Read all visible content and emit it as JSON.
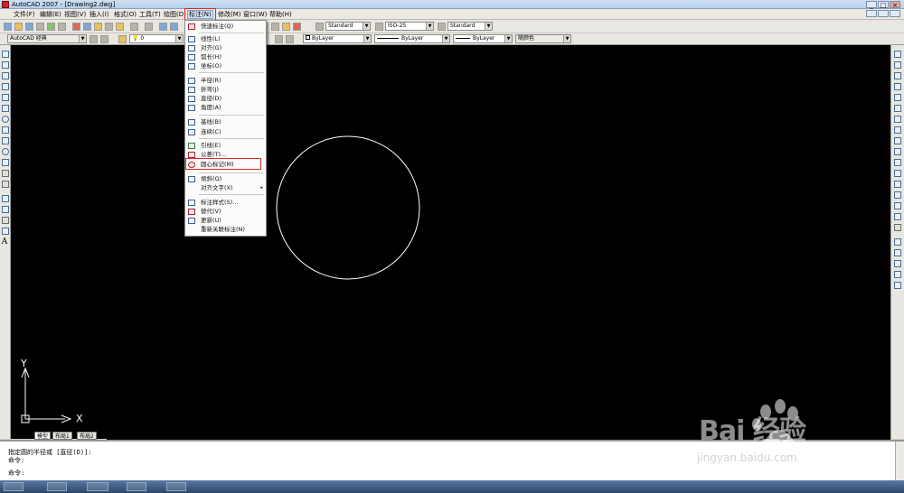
{
  "title": "AutoCAD 2007 - [Drawing2.dwg]",
  "window_buttons": [
    "_",
    "□",
    "×"
  ],
  "menu": [
    "文件(F)",
    "编辑(E)",
    "视图(V)",
    "插入(I)",
    "格式(O)",
    "工具(T)",
    "绘图(D)",
    "标注(N)",
    "修改(M)",
    "窗口(W)",
    "帮助(H)"
  ],
  "active_menu": "标注(N)",
  "toolbar": {
    "text_style": "Standard",
    "dim_style": "ISO-25",
    "table_style": "Standard",
    "workspace": "AutoCAD 经典",
    "layer": "0",
    "color": "ByLayer",
    "linetype": "ByLayer",
    "lineweight": "ByLayer",
    "plotstyle": "随颜色"
  },
  "dimension_menu": [
    {
      "label": "快速标注(Q)",
      "icon": "quick-dim-icon"
    },
    {
      "label": "线性(L)",
      "icon": "linear-dim-icon"
    },
    {
      "label": "对齐(G)",
      "icon": "aligned-dim-icon"
    },
    {
      "label": "弧长(H)",
      "icon": "arc-length-icon"
    },
    {
      "label": "坐标(O)",
      "icon": "ordinate-icon"
    },
    {
      "label": "半径(R)",
      "icon": "radius-icon"
    },
    {
      "label": "折弯(J)",
      "icon": "jogged-icon"
    },
    {
      "label": "直径(D)",
      "icon": "diameter-icon"
    },
    {
      "label": "角度(A)",
      "icon": "angle-icon"
    },
    {
      "label": "基线(B)",
      "icon": "baseline-icon"
    },
    {
      "label": "连续(C)",
      "icon": "continue-icon"
    },
    {
      "label": "引线(E)",
      "icon": "leader-icon"
    },
    {
      "label": "公差(T)...",
      "icon": "tolerance-icon"
    },
    {
      "label": "圆心标记(M)",
      "icon": "center-mark-icon"
    },
    {
      "label": "倾斜(Q)",
      "icon": "oblique-icon"
    },
    {
      "label": "对齐文字(X)",
      "icon": ""
    },
    {
      "label": "标注样式(S)...",
      "icon": "dim-style-icon"
    },
    {
      "label": "替代(V)",
      "icon": "override-icon"
    },
    {
      "label": "更新(U)",
      "icon": "update-icon"
    },
    {
      "label": "重新关联标注(N)",
      "icon": ""
    }
  ],
  "submenu_arrow": "▸",
  "highlighted_item": "圆心标记(M)",
  "tabs": [
    "模型",
    "布局1",
    "布局2"
  ],
  "ucs": {
    "x": "X",
    "y": "Y"
  },
  "command": [
    "指定圆的半径或 [直径(D)]:",
    "命令:",
    "命令:"
  ],
  "watermark": {
    "brand": "Bai 经验",
    "url": "jingyan.baidu.com"
  },
  "colors": {
    "canvas": "#000000",
    "highlight": "#d8282c",
    "circle": "#ffffff"
  }
}
